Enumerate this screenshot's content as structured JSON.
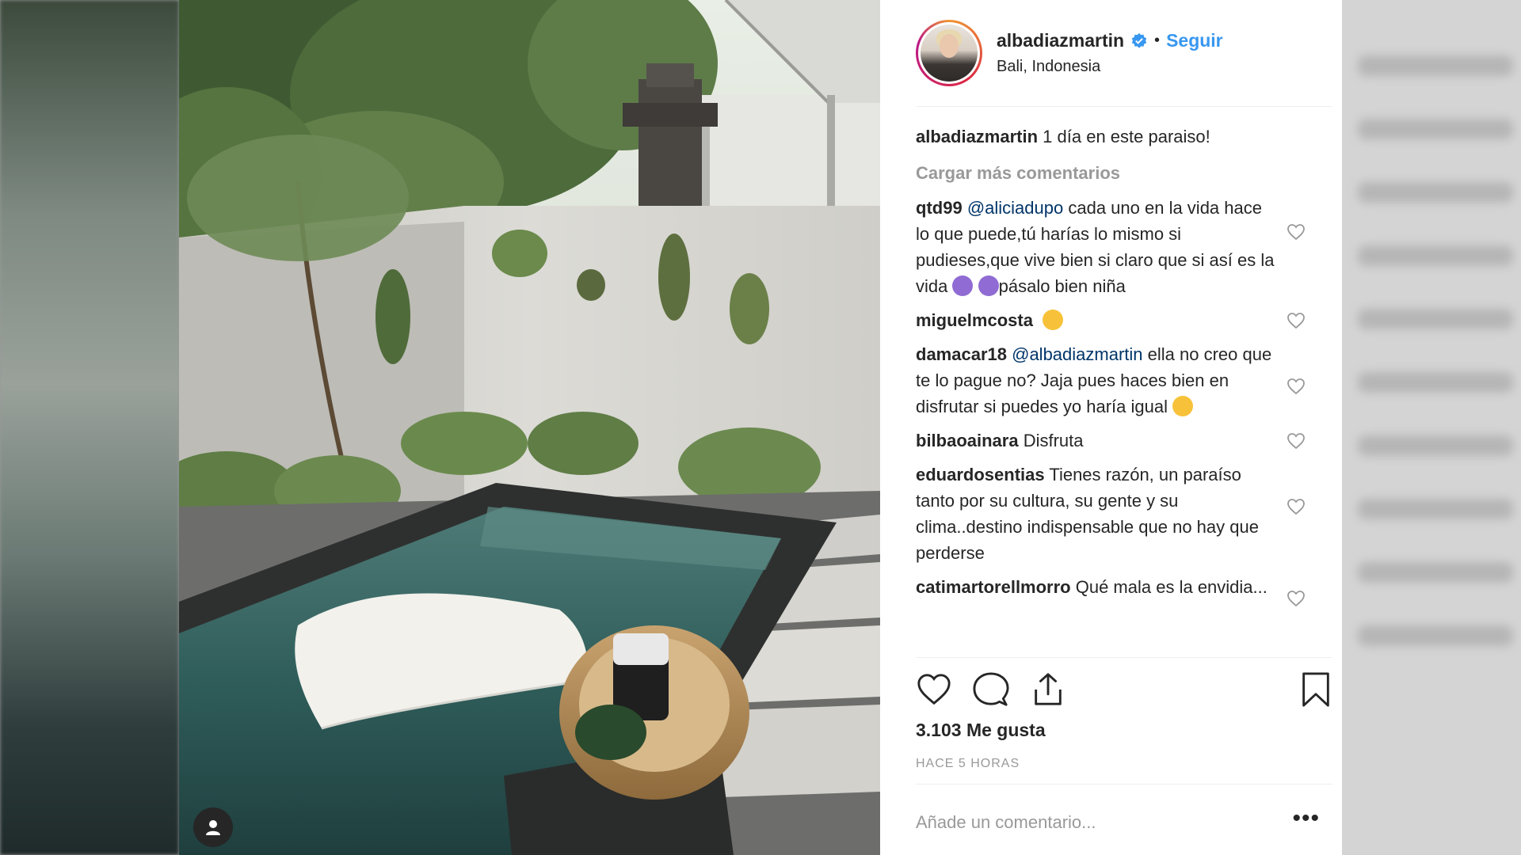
{
  "post": {
    "username": "albadiazmartin",
    "follow_label": "Seguir",
    "separator": "•",
    "location": "Bali, Indonesia",
    "verified_icon": "verified-badge-icon"
  },
  "caption": {
    "user": "albadiazmartin",
    "text": "1 día en este paraiso!"
  },
  "load_more_label": "Cargar más comentarios",
  "comments": [
    {
      "user": "qtd99",
      "mention": "@aliciadupo",
      "text": " cada uno en la vida hace lo que puede,tú harías lo mismo si pudieses,que vive bien si claro que si así es la vida",
      "text_after": "pásalo bien niña"
    },
    {
      "user": "miguelmcosta",
      "text": ""
    },
    {
      "user": "damacar18",
      "mention": "@albadiazmartin",
      "text": " ella no creo que te lo pague no? Jaja pues haces bien en disfrutar si puedes yo haría igual"
    },
    {
      "user": "bilbaoainara",
      "text": " Disfruta"
    },
    {
      "user": "eduardosentias",
      "text": " Tienes razón, un paraíso tanto por su cultura, su gente y su clima..destino indispensable que no hay que perderse"
    },
    {
      "user": "catimartorellmorro",
      "text": " Qué mala es la envidia..."
    }
  ],
  "likes_label": "3.103 Me gusta",
  "time_label": "HACE 5 HORAS",
  "add_comment": {
    "placeholder": "Añade un comentario...",
    "more_label": "•••"
  },
  "colors": {
    "accent": "#3897f0",
    "text": "#262626",
    "muted": "#999999",
    "mention": "#003569"
  }
}
